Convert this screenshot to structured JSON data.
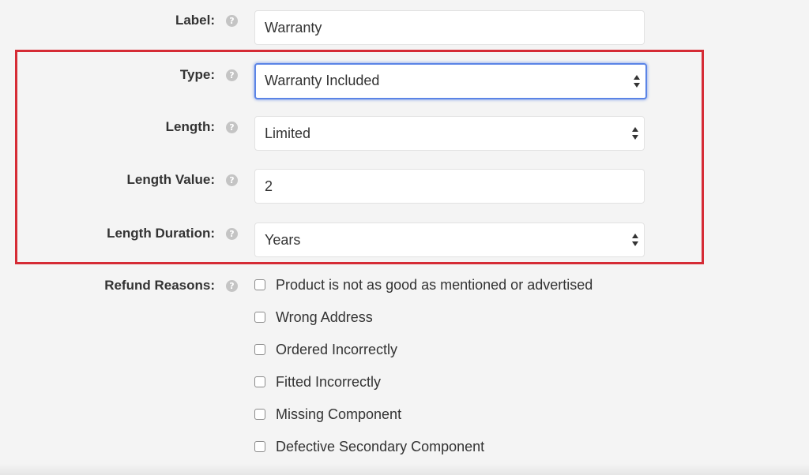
{
  "form": {
    "label": {
      "title": "Label:",
      "value": "Warranty"
    },
    "type": {
      "title": "Type:",
      "selected": "Warranty Included"
    },
    "length": {
      "title": "Length:",
      "selected": "Limited"
    },
    "length_value": {
      "title": "Length Value:",
      "value": "2"
    },
    "length_duration": {
      "title": "Length Duration:",
      "selected": "Years"
    },
    "refund_reasons": {
      "title": "Refund Reasons:",
      "options": [
        "Product is not as good as mentioned or advertised",
        "Wrong Address",
        "Ordered Incorrectly",
        "Fitted Incorrectly",
        "Missing Component",
        "Defective Secondary Component"
      ]
    }
  },
  "icons": {
    "help": "?"
  },
  "colors": {
    "highlight_border": "#d52b35",
    "focus_ring": "#5b84e6"
  }
}
